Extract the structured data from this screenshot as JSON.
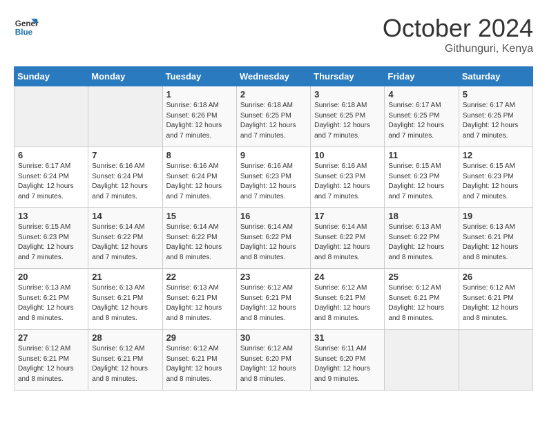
{
  "logo": {
    "line1": "General",
    "line2": "Blue"
  },
  "title": "October 2024",
  "location": "Githunguri, Kenya",
  "days_of_week": [
    "Sunday",
    "Monday",
    "Tuesday",
    "Wednesday",
    "Thursday",
    "Friday",
    "Saturday"
  ],
  "weeks": [
    [
      {
        "num": "",
        "empty": true
      },
      {
        "num": "",
        "empty": true
      },
      {
        "num": "1",
        "sunrise": "6:18 AM",
        "sunset": "6:26 PM",
        "daylight": "12 hours and 7 minutes."
      },
      {
        "num": "2",
        "sunrise": "6:18 AM",
        "sunset": "6:25 PM",
        "daylight": "12 hours and 7 minutes."
      },
      {
        "num": "3",
        "sunrise": "6:18 AM",
        "sunset": "6:25 PM",
        "daylight": "12 hours and 7 minutes."
      },
      {
        "num": "4",
        "sunrise": "6:17 AM",
        "sunset": "6:25 PM",
        "daylight": "12 hours and 7 minutes."
      },
      {
        "num": "5",
        "sunrise": "6:17 AM",
        "sunset": "6:25 PM",
        "daylight": "12 hours and 7 minutes."
      }
    ],
    [
      {
        "num": "6",
        "sunrise": "6:17 AM",
        "sunset": "6:24 PM",
        "daylight": "12 hours and 7 minutes."
      },
      {
        "num": "7",
        "sunrise": "6:16 AM",
        "sunset": "6:24 PM",
        "daylight": "12 hours and 7 minutes."
      },
      {
        "num": "8",
        "sunrise": "6:16 AM",
        "sunset": "6:24 PM",
        "daylight": "12 hours and 7 minutes."
      },
      {
        "num": "9",
        "sunrise": "6:16 AM",
        "sunset": "6:23 PM",
        "daylight": "12 hours and 7 minutes."
      },
      {
        "num": "10",
        "sunrise": "6:16 AM",
        "sunset": "6:23 PM",
        "daylight": "12 hours and 7 minutes."
      },
      {
        "num": "11",
        "sunrise": "6:15 AM",
        "sunset": "6:23 PM",
        "daylight": "12 hours and 7 minutes."
      },
      {
        "num": "12",
        "sunrise": "6:15 AM",
        "sunset": "6:23 PM",
        "daylight": "12 hours and 7 minutes."
      }
    ],
    [
      {
        "num": "13",
        "sunrise": "6:15 AM",
        "sunset": "6:23 PM",
        "daylight": "12 hours and 7 minutes."
      },
      {
        "num": "14",
        "sunrise": "6:14 AM",
        "sunset": "6:22 PM",
        "daylight": "12 hours and 7 minutes."
      },
      {
        "num": "15",
        "sunrise": "6:14 AM",
        "sunset": "6:22 PM",
        "daylight": "12 hours and 8 minutes."
      },
      {
        "num": "16",
        "sunrise": "6:14 AM",
        "sunset": "6:22 PM",
        "daylight": "12 hours and 8 minutes."
      },
      {
        "num": "17",
        "sunrise": "6:14 AM",
        "sunset": "6:22 PM",
        "daylight": "12 hours and 8 minutes."
      },
      {
        "num": "18",
        "sunrise": "6:13 AM",
        "sunset": "6:22 PM",
        "daylight": "12 hours and 8 minutes."
      },
      {
        "num": "19",
        "sunrise": "6:13 AM",
        "sunset": "6:21 PM",
        "daylight": "12 hours and 8 minutes."
      }
    ],
    [
      {
        "num": "20",
        "sunrise": "6:13 AM",
        "sunset": "6:21 PM",
        "daylight": "12 hours and 8 minutes."
      },
      {
        "num": "21",
        "sunrise": "6:13 AM",
        "sunset": "6:21 PM",
        "daylight": "12 hours and 8 minutes."
      },
      {
        "num": "22",
        "sunrise": "6:13 AM",
        "sunset": "6:21 PM",
        "daylight": "12 hours and 8 minutes."
      },
      {
        "num": "23",
        "sunrise": "6:12 AM",
        "sunset": "6:21 PM",
        "daylight": "12 hours and 8 minutes."
      },
      {
        "num": "24",
        "sunrise": "6:12 AM",
        "sunset": "6:21 PM",
        "daylight": "12 hours and 8 minutes."
      },
      {
        "num": "25",
        "sunrise": "6:12 AM",
        "sunset": "6:21 PM",
        "daylight": "12 hours and 8 minutes."
      },
      {
        "num": "26",
        "sunrise": "6:12 AM",
        "sunset": "6:21 PM",
        "daylight": "12 hours and 8 minutes."
      }
    ],
    [
      {
        "num": "27",
        "sunrise": "6:12 AM",
        "sunset": "6:21 PM",
        "daylight": "12 hours and 8 minutes."
      },
      {
        "num": "28",
        "sunrise": "6:12 AM",
        "sunset": "6:21 PM",
        "daylight": "12 hours and 8 minutes."
      },
      {
        "num": "29",
        "sunrise": "6:12 AM",
        "sunset": "6:21 PM",
        "daylight": "12 hours and 8 minutes."
      },
      {
        "num": "30",
        "sunrise": "6:12 AM",
        "sunset": "6:20 PM",
        "daylight": "12 hours and 8 minutes."
      },
      {
        "num": "31",
        "sunrise": "6:11 AM",
        "sunset": "6:20 PM",
        "daylight": "12 hours and 9 minutes."
      },
      {
        "num": "",
        "empty": true
      },
      {
        "num": "",
        "empty": true
      }
    ]
  ],
  "colors": {
    "header_bg": "#2a7abf",
    "logo_blue": "#1a6faf"
  }
}
